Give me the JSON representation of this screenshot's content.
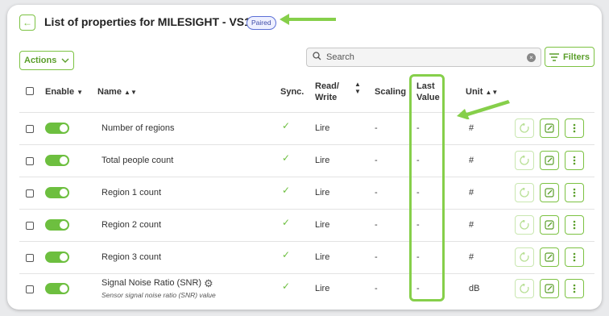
{
  "header": {
    "title": "List of properties for MILESIGHT - VS121",
    "badge": "Paired"
  },
  "toolbar": {
    "actions_label": "Actions",
    "search_placeholder": "Search",
    "filters_label": "Filters"
  },
  "columns": {
    "enable": "Enable",
    "name": "Name",
    "sync": "Sync.",
    "rw_line1": "Read/",
    "rw_line2": "Write",
    "scaling": "Scaling",
    "last_line1": "Last",
    "last_line2": "Value",
    "unit": "Unit"
  },
  "rows": [
    {
      "name": "Number of regions",
      "sync": "✓",
      "rw": "Lire",
      "scaling": "-",
      "last": "-",
      "unit": "#"
    },
    {
      "name": "Total people count",
      "sync": "✓",
      "rw": "Lire",
      "scaling": "-",
      "last": "-",
      "unit": "#"
    },
    {
      "name": "Region 1 count",
      "sync": "✓",
      "rw": "Lire",
      "scaling": "-",
      "last": "-",
      "unit": "#"
    },
    {
      "name": "Region 2 count",
      "sync": "✓",
      "rw": "Lire",
      "scaling": "-",
      "last": "-",
      "unit": "#"
    },
    {
      "name": "Region 3 count",
      "sync": "✓",
      "rw": "Lire",
      "scaling": "-",
      "last": "-",
      "unit": "#"
    },
    {
      "name": "Signal Noise Ratio (SNR)",
      "desc": "Sensor signal noise ratio (SNR) value",
      "sync": "✓",
      "rw": "Lire",
      "scaling": "-",
      "last": "-",
      "unit": "dB"
    }
  ],
  "colors": {
    "accent": "#7cc242",
    "toggle_on": "#6dbf3f",
    "badge": "#5b6fd6"
  }
}
